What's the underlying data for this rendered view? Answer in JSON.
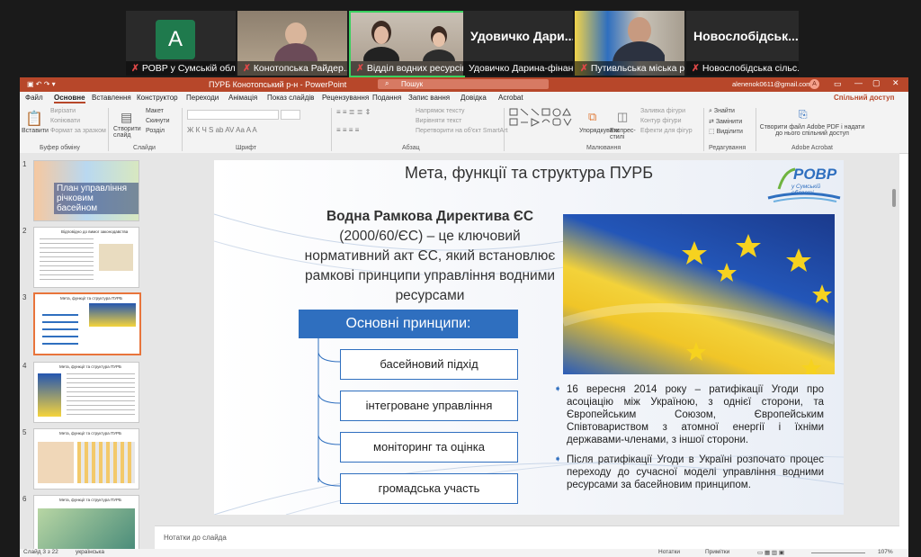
{
  "zoom": {
    "tiles": [
      {
        "name": "РОВР у Сумській обла...",
        "initial": "A",
        "muted": true
      },
      {
        "name": "Конотопська Райдер...",
        "muted": true
      },
      {
        "name": "Відділ водних ресурсів Р...",
        "muted": true
      },
      {
        "name": "Удовичко Дарина-фінанс...",
        "big": "Удовичко Дари...",
        "muted": false
      },
      {
        "name": "Путивльська міська р...",
        "muted": true
      },
      {
        "name": "Новослобідська сільс...",
        "big": "Новослобідськ...",
        "muted": true
      }
    ]
  },
  "ppt": {
    "title": "ПУРБ Конотопський р-н  -  PowerPoint",
    "search_placeholder": "Пошук",
    "account": "alenenok0611@gmail.com",
    "account_initial": "A",
    "share": "Спільний доступ",
    "menu": [
      "Файл",
      "Основне",
      "Вставлення",
      "Конструктор",
      "Переходи",
      "Анімація",
      "Показ слайдів",
      "Рецензування",
      "Подання",
      "Запис вання",
      "Довідка",
      "Acrobat"
    ],
    "ribbon": {
      "paste": "Вставити",
      "cut": "Вирізати",
      "copy": "Копіювати",
      "format_painter": "Формат за зразком",
      "clipboard_group": "Буфер обміну",
      "new_slide": "Створити слайд",
      "layout": "Макет",
      "reset": "Скинути",
      "section": "Розділ",
      "slides_group": "Слайди",
      "font_group": "Шрифт",
      "text_direction": "Напрямок тексту",
      "align_text": "Вирівняти текст",
      "smartart": "Перетворити на об'єкт SmartArt",
      "paragraph_group": "Абзац",
      "arrange": "Упорядкувати",
      "quick_styles": "Експрес-стилі",
      "shape_fill": "Заливка фігури",
      "shape_outline": "Контур фігури",
      "shape_effects": "Ефекти для фігур",
      "drawing_group": "Малювання",
      "find": "Знайти",
      "replace": "Замінити",
      "select": "Виділити",
      "editing_group": "Редагування",
      "create_pdf": "Створити файл Adobe PDF і надати до нього спільний доступ",
      "acrobat_group": "Adobe Acrobat"
    },
    "thumbnails": [
      {
        "num": "1",
        "title": "План управління річковим басейном"
      },
      {
        "num": "2",
        "title": "Відповідно до вимог законодавства"
      },
      {
        "num": "3",
        "title": "Мета, функції та структура ПУРБ"
      },
      {
        "num": "4",
        "title": "Мета, функції та структура ПУРБ"
      },
      {
        "num": "5",
        "title": "Мета, функції та структура ПУРБ"
      },
      {
        "num": "6",
        "title": "Мета, функції та структура ПУРБ"
      }
    ],
    "notes_placeholder": "Нотатки до слайда",
    "status": {
      "slide": "Слайд 3 з 22",
      "language": "українська",
      "notes": "Нотатки",
      "comments": "Примітки",
      "zoom": "107%"
    }
  },
  "slide": {
    "title": "Мета, функції та структура ПУРБ",
    "logo": {
      "main": "РОВР",
      "sub": "у Сумській області"
    },
    "wfd_title": "Водна Рамкова Директива ЄС",
    "wfd_text": "(2000/60/ЄС) – це ключовий нормативний акт ЄС, який встановлює рамкові принципи управління водними ресурсами",
    "principles_header": "Основні принципи:",
    "principles": [
      "басейновий підхід",
      "інтегроване управління",
      "моніторинг та оцінка",
      "громадська участь"
    ],
    "bullets": [
      "16 вересня 2014 року – ратифікації Угоди про асоціацію між Україною, з однієї сторони, та Європейським Союзом, Європейським Співтовариством з атомної енергії і їхніми державами-членами, з іншої сторони.",
      "Після ратифікації Угоди в Україні розпочато процес переходу до сучасної моделі управління водними ресурсами за басейновим принципом."
    ],
    "colors": {
      "accent": "#2f6fbf",
      "ppt_brand": "#b7472a",
      "active_border": "#e8743b"
    }
  }
}
